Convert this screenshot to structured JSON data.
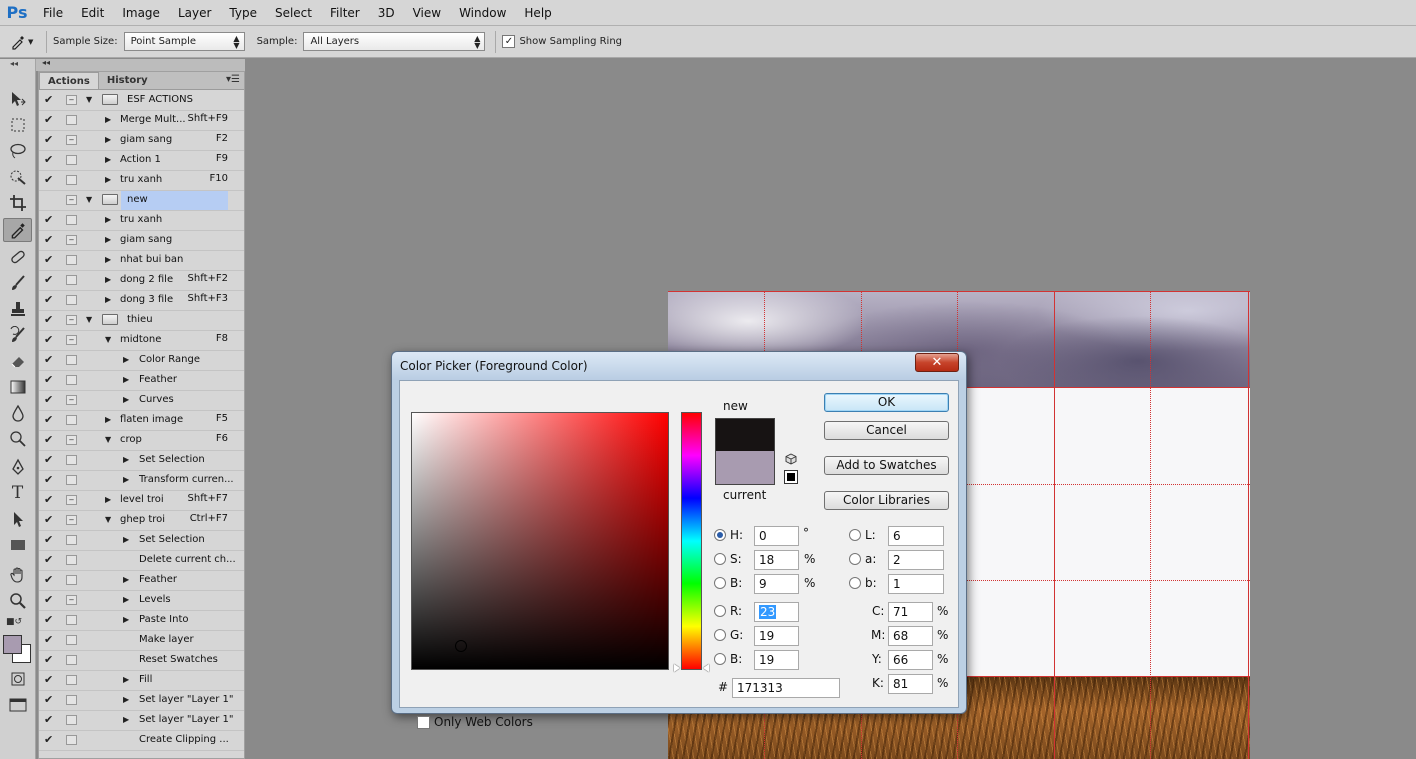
{
  "app": {
    "logo": "Ps"
  },
  "menu": [
    "File",
    "Edit",
    "Image",
    "Layer",
    "Type",
    "Select",
    "Filter",
    "3D",
    "View",
    "Window",
    "Help"
  ],
  "options": {
    "sample_size_label": "Sample Size:",
    "sample_size_value": "Point Sample",
    "sample_label": "Sample:",
    "sample_value": "All Layers",
    "show_ring_label": "Show Sampling Ring",
    "show_ring_checked": true
  },
  "panel": {
    "tabs": [
      "Actions",
      "History"
    ],
    "active_tab": "Actions",
    "rows": [
      {
        "level": 0,
        "folder": true,
        "name": "ESF ACTIONS",
        "key": ""
      },
      {
        "level": 1,
        "folder": false,
        "name": "Merge Mult...",
        "key": "Shft+F9"
      },
      {
        "level": 1,
        "folder": false,
        "name": "giam sang",
        "key": "F2"
      },
      {
        "level": 1,
        "folder": false,
        "name": "Action 1",
        "key": "F9"
      },
      {
        "level": 1,
        "folder": false,
        "name": "tru xanh",
        "key": "F10"
      },
      {
        "level": 0,
        "folder": true,
        "name": "new",
        "key": "",
        "selected": true
      },
      {
        "level": 1,
        "folder": false,
        "name": "tru xanh",
        "key": ""
      },
      {
        "level": 1,
        "folder": false,
        "name": "giam sang",
        "key": ""
      },
      {
        "level": 1,
        "folder": false,
        "name": "nhat bui ban",
        "key": ""
      },
      {
        "level": 1,
        "folder": false,
        "name": "dong 2 file",
        "key": "Shft+F2"
      },
      {
        "level": 1,
        "folder": false,
        "name": "dong 3 file",
        "key": "Shft+F3"
      },
      {
        "level": 0,
        "folder": true,
        "name": "thieu",
        "key": ""
      },
      {
        "level": 1,
        "folder": false,
        "name": "midtone",
        "key": "F8",
        "open": true
      },
      {
        "level": 2,
        "folder": false,
        "name": "Color Range",
        "key": ""
      },
      {
        "level": 2,
        "folder": false,
        "name": "Feather",
        "key": ""
      },
      {
        "level": 2,
        "folder": false,
        "name": "Curves",
        "key": ""
      },
      {
        "level": 1,
        "folder": false,
        "name": "flaten image",
        "key": "F5"
      },
      {
        "level": 1,
        "folder": false,
        "name": "crop",
        "key": "F6",
        "open": true
      },
      {
        "level": 2,
        "folder": false,
        "name": "Set Selection",
        "key": ""
      },
      {
        "level": 2,
        "folder": false,
        "name": "Transform curren...",
        "key": ""
      },
      {
        "level": 1,
        "folder": false,
        "name": "level troi",
        "key": "Shft+F7"
      },
      {
        "level": 1,
        "folder": false,
        "name": "ghep troi",
        "key": "Ctrl+F7",
        "open": true
      },
      {
        "level": 2,
        "folder": false,
        "name": "Set Selection",
        "key": ""
      },
      {
        "level": 2,
        "folder": false,
        "name": "Delete current ch...",
        "key": "",
        "notri": true
      },
      {
        "level": 2,
        "folder": false,
        "name": "Feather",
        "key": ""
      },
      {
        "level": 2,
        "folder": false,
        "name": "Levels",
        "key": ""
      },
      {
        "level": 2,
        "folder": false,
        "name": "Paste Into",
        "key": ""
      },
      {
        "level": 2,
        "folder": false,
        "name": "Make layer",
        "key": "",
        "notri": true
      },
      {
        "level": 2,
        "folder": false,
        "name": "Reset Swatches",
        "key": "",
        "notri": true
      },
      {
        "level": 2,
        "folder": false,
        "name": "Fill",
        "key": ""
      },
      {
        "level": 2,
        "folder": false,
        "name": "Set layer \"Layer 1\"",
        "key": ""
      },
      {
        "level": 2,
        "folder": false,
        "name": "Set layer \"Layer 1\"",
        "key": ""
      },
      {
        "level": 2,
        "folder": false,
        "name": "Create Clipping ...",
        "key": "",
        "notri": true
      }
    ]
  },
  "dialog": {
    "title": "Color Picker (Foreground Color)",
    "new_label": "new",
    "current_label": "current",
    "new_color": "#171313",
    "current_color": "#a89bb0",
    "buttons": {
      "ok": "OK",
      "cancel": "Cancel",
      "add_swatches": "Add to Swatches",
      "color_libraries": "Color Libraries"
    },
    "fields": {
      "H": "0",
      "S": "18",
      "B": "9",
      "R": "23",
      "G": "19",
      "Bv": "19",
      "L": "6",
      "a": "2",
      "b": "1",
      "C": "71",
      "M": "68",
      "Y": "66",
      "K": "81"
    },
    "labels": {
      "H": "H:",
      "S": "S:",
      "B": "B:",
      "R": "R:",
      "G": "G:",
      "Bv": "B:",
      "L": "L:",
      "a": "a:",
      "b": "b:",
      "C": "C:",
      "M": "M:",
      "Y": "Y:",
      "K": "K:"
    },
    "units": {
      "degree": "°",
      "percent": "%"
    },
    "hex_label": "#",
    "hex": "171313",
    "only_web_colors": "Only Web Colors"
  },
  "colors": {
    "foreground": "#a89bb0",
    "background": "#ffffff",
    "guide": "#d23333"
  }
}
